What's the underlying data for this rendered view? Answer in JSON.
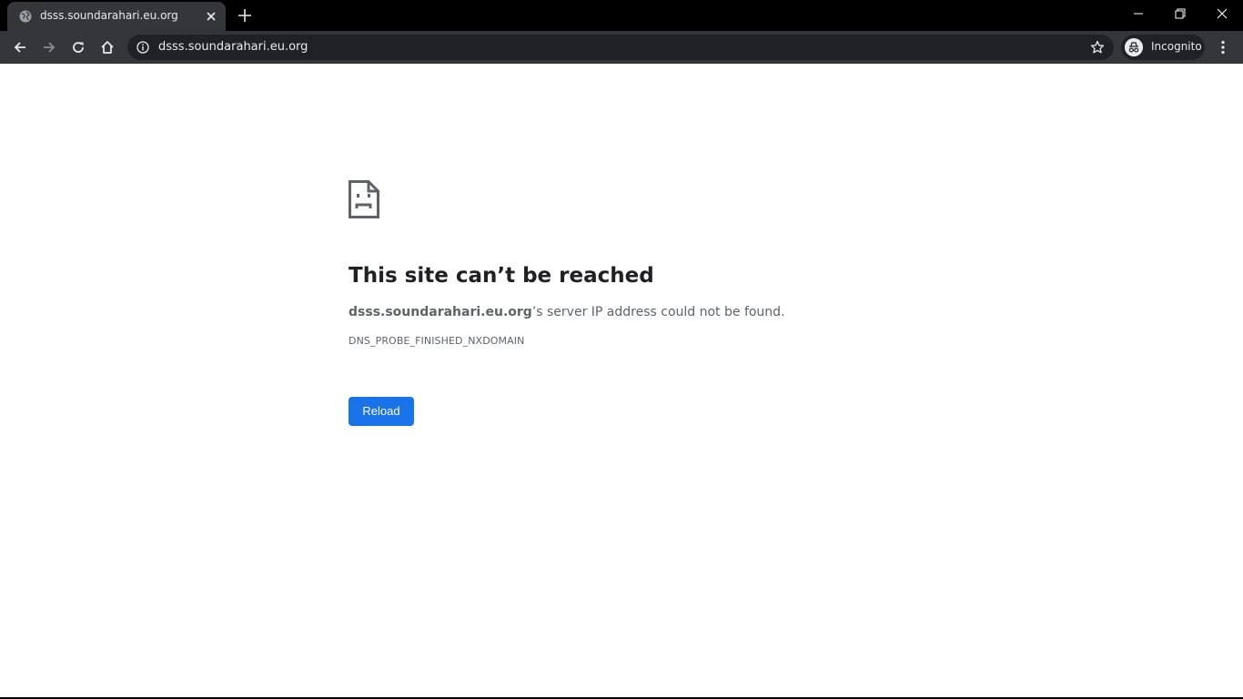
{
  "tab": {
    "title": "dsss.soundarahari.eu.org"
  },
  "omnibox": {
    "url": "dsss.soundarahari.eu.org"
  },
  "profile": {
    "label": "Incognito"
  },
  "error": {
    "title": "This site can’t be reached",
    "host": "dsss.soundarahari.eu.org",
    "message": "’s server IP address could not be found.",
    "code": "DNS_PROBE_FINISHED_NXDOMAIN",
    "reload_label": "Reload"
  },
  "icons": {
    "favicon": "globe-icon",
    "tab_close": "close-icon",
    "new_tab": "plus-icon",
    "back": "arrow-left-icon",
    "forward": "arrow-right-icon",
    "reload": "reload-icon",
    "home": "home-icon",
    "site_info": "info-icon",
    "bookmark": "star-icon",
    "incognito": "incognito-icon",
    "menu": "kebab-menu-icon",
    "error": "sad-page-icon"
  },
  "colors": {
    "accent": "#1a73e8",
    "toolbar": "#35363a",
    "omnibox": "#202124",
    "frame": "#000000"
  }
}
